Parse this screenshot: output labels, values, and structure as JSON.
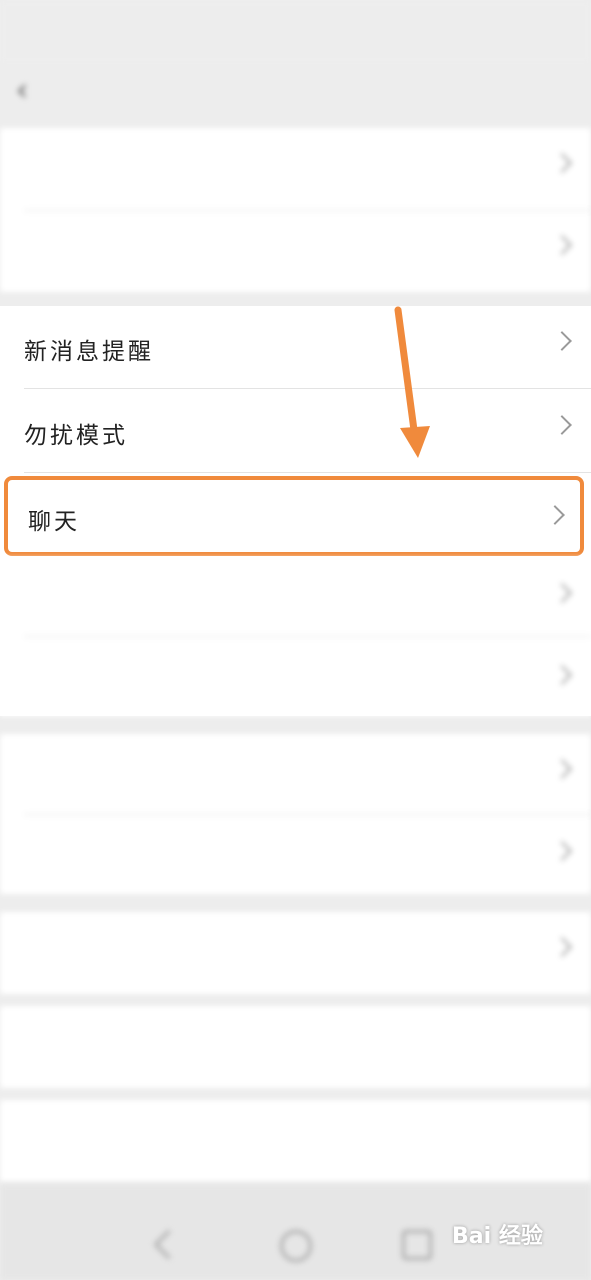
{
  "status_bar": {
    "left_text": "",
    "right_text": ""
  },
  "header": {
    "title": "",
    "back_icon": "back-arrow-icon"
  },
  "group1": {
    "rows": [
      {
        "label": ""
      },
      {
        "label": "",
        "value": ""
      }
    ]
  },
  "group2": {
    "rows": [
      {
        "label": "新消息提醒"
      },
      {
        "label": "勿扰模式"
      },
      {
        "label": "聊天"
      },
      {
        "label": ""
      },
      {
        "label": ""
      }
    ]
  },
  "group3": {
    "rows": [
      {
        "label": ""
      },
      {
        "label": ""
      }
    ]
  },
  "group4": {
    "rows": [
      {
        "label": ""
      }
    ]
  },
  "buttons": {
    "switch_account": "",
    "logout": ""
  },
  "annotation": {
    "color": "#f08a3c",
    "arrow_icon": "down-arrow-icon"
  },
  "watermark": {
    "text": "Bai 经验"
  },
  "colors": {
    "background": "#ededed",
    "card": "#ffffff",
    "accent": "#f08a3c"
  }
}
